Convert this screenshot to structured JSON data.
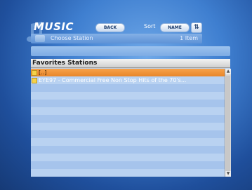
{
  "app": {
    "title": "MUSIC"
  },
  "toolbar": {
    "back_label": "BACK",
    "sort_label": "Sort",
    "sort_value": "NAME",
    "sort_order_glyph": "⇅"
  },
  "station_bar": {
    "label": "Choose Station",
    "count": "1 Item"
  },
  "list": {
    "header": "Favorites Stations",
    "items": [
      {
        "label": "[..]",
        "selected": true
      },
      {
        "label": "EYE97 - Commercial Free Non Stop Hits of the 70's...",
        "selected": false
      }
    ]
  },
  "icons": {
    "app_icon": "music-note-icon",
    "station_icon": "station-icon",
    "folder_icon": "folder-icon",
    "scroll_up": "scroll-up-arrow-icon",
    "scroll_down": "scroll-down-arrow-icon"
  },
  "colors": {
    "selection": "#e8862a",
    "list_background": "#b9d2f1",
    "screen_background": "#3f7fd0"
  }
}
